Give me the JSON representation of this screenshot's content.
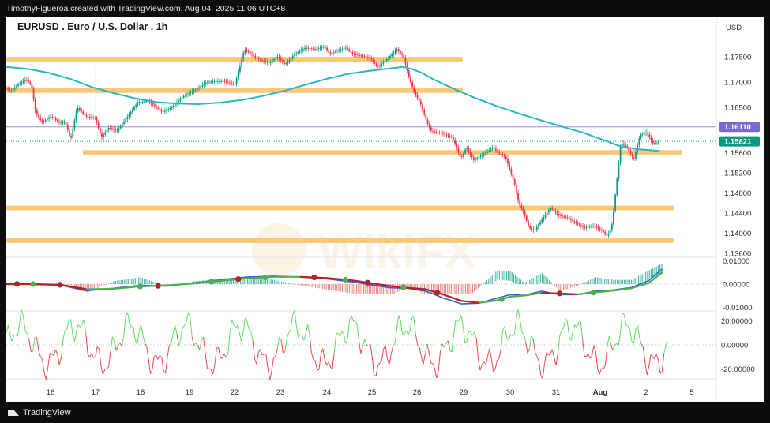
{
  "header": {
    "attribution": "TimothyFigueroa created with TradingView.com, Aug 04, 2025 11:06 UTC+8"
  },
  "footer": {
    "brand": "TradingView"
  },
  "watermark": {
    "text": "WikiFX"
  },
  "colors": {
    "background": "#ffffff",
    "frame": "#0d0d0d",
    "up_candle": "#089981",
    "down_candle": "#f23645",
    "ma_line": "#26b7c7",
    "zones": "#f9c97a",
    "pivot_line": "#9c8fd6",
    "macd_line": "#2b5fd9",
    "signal_line_up": "#4caf50",
    "signal_line_down": "#b22222",
    "osc_up": "#5be35b",
    "osc_down": "#e84a4a",
    "badge_purple": "#7b68d6",
    "badge_green": "#089981"
  },
  "chart_data": {
    "type": "candlestick",
    "title": "EURUSD . Euro / U.S. Dollar . 1h",
    "currency": "USD",
    "x_ticks": [
      "16",
      "17",
      "18",
      "19",
      "22",
      "23",
      "24",
      "25",
      "26",
      "29",
      "30",
      "31",
      "Aug",
      "2",
      "5"
    ],
    "price_ticks": [
      "1.17500",
      "1.17000",
      "1.16500",
      "1.15600",
      "1.15200",
      "1.14800",
      "1.14400",
      "1.14000",
      "1.13600"
    ],
    "price_range": [
      1.1352,
      1.1797
    ],
    "last_price": "1.15821",
    "pivot_price": "1.16110",
    "zones": [
      {
        "price": 1.1745
      },
      {
        "price": 1.1683
      },
      {
        "price": 1.156
      },
      {
        "price": 1.145
      },
      {
        "price": 1.1385
      }
    ],
    "price_path": [
      [
        0,
        1.1689
      ],
      [
        6,
        1.1682
      ],
      [
        12,
        1.1694
      ],
      [
        20,
        1.1705
      ],
      [
        25,
        1.1695
      ],
      [
        29,
        1.164
      ],
      [
        35,
        1.162
      ],
      [
        44,
        1.1632
      ],
      [
        52,
        1.1618
      ],
      [
        57,
        1.162
      ],
      [
        62,
        1.1585
      ],
      [
        68,
        1.165
      ],
      [
        76,
        1.1632
      ],
      [
        85,
        1.1628
      ],
      [
        91,
        1.159
      ],
      [
        98,
        1.161
      ],
      [
        105,
        1.1602
      ],
      [
        115,
        1.163
      ],
      [
        125,
        1.166
      ],
      [
        135,
        1.1662
      ],
      [
        148,
        1.164
      ],
      [
        157,
        1.165
      ],
      [
        168,
        1.1672
      ],
      [
        178,
        1.1683
      ],
      [
        190,
        1.17
      ],
      [
        205,
        1.1702
      ],
      [
        216,
        1.1695
      ],
      [
        225,
        1.1765
      ],
      [
        238,
        1.1745
      ],
      [
        248,
        1.1738
      ],
      [
        256,
        1.175
      ],
      [
        263,
        1.1735
      ],
      [
        272,
        1.1755
      ],
      [
        282,
        1.1768
      ],
      [
        292,
        1.1765
      ],
      [
        300,
        1.177
      ],
      [
        305,
        1.1756
      ],
      [
        312,
        1.1762
      ],
      [
        320,
        1.1768
      ],
      [
        327,
        1.1755
      ],
      [
        335,
        1.1752
      ],
      [
        343,
        1.1747
      ],
      [
        350,
        1.173
      ],
      [
        360,
        1.1748
      ],
      [
        368,
        1.1765
      ],
      [
        374,
        1.175
      ],
      [
        380,
        1.1705
      ],
      [
        384,
        1.168
      ],
      [
        390,
        1.1658
      ],
      [
        396,
        1.162
      ],
      [
        400,
        1.1603
      ],
      [
        410,
        1.1598
      ],
      [
        420,
        1.159
      ],
      [
        428,
        1.1548
      ],
      [
        433,
        1.157
      ],
      [
        440,
        1.1545
      ],
      [
        448,
        1.1555
      ],
      [
        458,
        1.157
      ],
      [
        463,
        1.156
      ],
      [
        470,
        1.155
      ],
      [
        478,
        1.15
      ],
      [
        482,
        1.146
      ],
      [
        487,
        1.144
      ],
      [
        492,
        1.141
      ],
      [
        497,
        1.1405
      ],
      [
        505,
        1.143
      ],
      [
        512,
        1.145
      ],
      [
        520,
        1.1435
      ],
      [
        528,
        1.143
      ],
      [
        536,
        1.142
      ],
      [
        544,
        1.141
      ],
      [
        552,
        1.1415
      ],
      [
        560,
        1.1405
      ],
      [
        565,
        1.1395
      ],
      [
        567,
        1.14
      ],
      [
        570,
        1.142
      ],
      [
        574,
        1.15
      ],
      [
        578,
        1.158
      ],
      [
        584,
        1.157
      ],
      [
        590,
        1.1545
      ],
      [
        596,
        1.1595
      ],
      [
        602,
        1.16
      ],
      [
        608,
        1.1578
      ],
      [
        612,
        1.158
      ]
    ],
    "ma_path": [
      [
        0,
        1.173
      ],
      [
        20,
        1.1726
      ],
      [
        40,
        1.1718
      ],
      [
        60,
        1.1706
      ],
      [
        80,
        1.169
      ],
      [
        100,
        1.1678
      ],
      [
        120,
        1.1668
      ],
      [
        140,
        1.166
      ],
      [
        160,
        1.1657
      ],
      [
        180,
        1.1656
      ],
      [
        200,
        1.1659
      ],
      [
        220,
        1.1664
      ],
      [
        240,
        1.1672
      ],
      [
        260,
        1.1682
      ],
      [
        280,
        1.1694
      ],
      [
        300,
        1.1706
      ],
      [
        320,
        1.1716
      ],
      [
        340,
        1.1722
      ],
      [
        360,
        1.1727
      ],
      [
        372,
        1.173
      ],
      [
        380,
        1.1726
      ],
      [
        390,
        1.1718
      ],
      [
        400,
        1.1706
      ],
      [
        420,
        1.1686
      ],
      [
        440,
        1.1668
      ],
      [
        460,
        1.1652
      ],
      [
        480,
        1.1638
      ],
      [
        500,
        1.1625
      ],
      [
        520,
        1.1612
      ],
      [
        540,
        1.16
      ],
      [
        560,
        1.1585
      ],
      [
        575,
        1.1573
      ],
      [
        590,
        1.1567
      ],
      [
        612,
        1.1563
      ]
    ],
    "macd": {
      "ticks": [
        "0.01000",
        "0.00000",
        "-0.01000"
      ],
      "range": [
        -0.0115,
        0.0115
      ],
      "macd_path": [
        [
          0,
          0.0
        ],
        [
          30,
          -0.0001
        ],
        [
          60,
          -0.0004
        ],
        [
          90,
          -0.0028
        ],
        [
          120,
          -0.0018
        ],
        [
          150,
          -0.0005
        ],
        [
          180,
          -0.0008
        ],
        [
          210,
          0.0005
        ],
        [
          240,
          0.0018
        ],
        [
          270,
          0.003
        ],
        [
          300,
          0.0034
        ],
        [
          330,
          0.003
        ],
        [
          360,
          0.0022
        ],
        [
          390,
          0.0008
        ],
        [
          410,
          -0.0004
        ],
        [
          430,
          -0.0016
        ],
        [
          450,
          -0.0018
        ],
        [
          470,
          -0.003
        ],
        [
          490,
          -0.006
        ],
        [
          510,
          -0.0085
        ],
        [
          530,
          -0.0082
        ],
        [
          550,
          -0.006
        ],
        [
          565,
          -0.0045
        ],
        [
          580,
          -0.0048
        ],
        [
          600,
          -0.003
        ],
        [
          620,
          -0.0045
        ],
        [
          640,
          -0.0045
        ],
        [
          660,
          -0.003
        ],
        [
          680,
          -0.0025
        ],
        [
          700,
          -0.0015
        ],
        [
          720,
          0.0015
        ],
        [
          735,
          0.0065
        ]
      ],
      "signal_path": [
        [
          0,
          0.0001
        ],
        [
          30,
          0.0
        ],
        [
          60,
          -0.0003
        ],
        [
          90,
          -0.0022
        ],
        [
          120,
          -0.002
        ],
        [
          150,
          -0.001
        ],
        [
          180,
          -0.0006
        ],
        [
          210,
          0.0003
        ],
        [
          240,
          0.0014
        ],
        [
          270,
          0.0025
        ],
        [
          300,
          0.0031
        ],
        [
          330,
          0.0031
        ],
        [
          360,
          0.0026
        ],
        [
          390,
          0.0015
        ],
        [
          410,
          0.0003
        ],
        [
          430,
          -0.0008
        ],
        [
          450,
          -0.0016
        ],
        [
          470,
          -0.0022
        ],
        [
          490,
          -0.0045
        ],
        [
          510,
          -0.0072
        ],
        [
          530,
          -0.008
        ],
        [
          550,
          -0.007
        ],
        [
          565,
          -0.0054
        ],
        [
          580,
          -0.0049
        ],
        [
          600,
          -0.0038
        ],
        [
          620,
          -0.004
        ],
        [
          640,
          -0.0044
        ],
        [
          660,
          -0.0035
        ],
        [
          680,
          -0.0028
        ],
        [
          700,
          -0.0018
        ],
        [
          720,
          0.0005
        ],
        [
          735,
          0.005
        ]
      ]
    },
    "oscillator": {
      "ticks": [
        "20.00000",
        "0.00000",
        "-20.00000"
      ],
      "range": [
        -28,
        28
      ]
    }
  }
}
